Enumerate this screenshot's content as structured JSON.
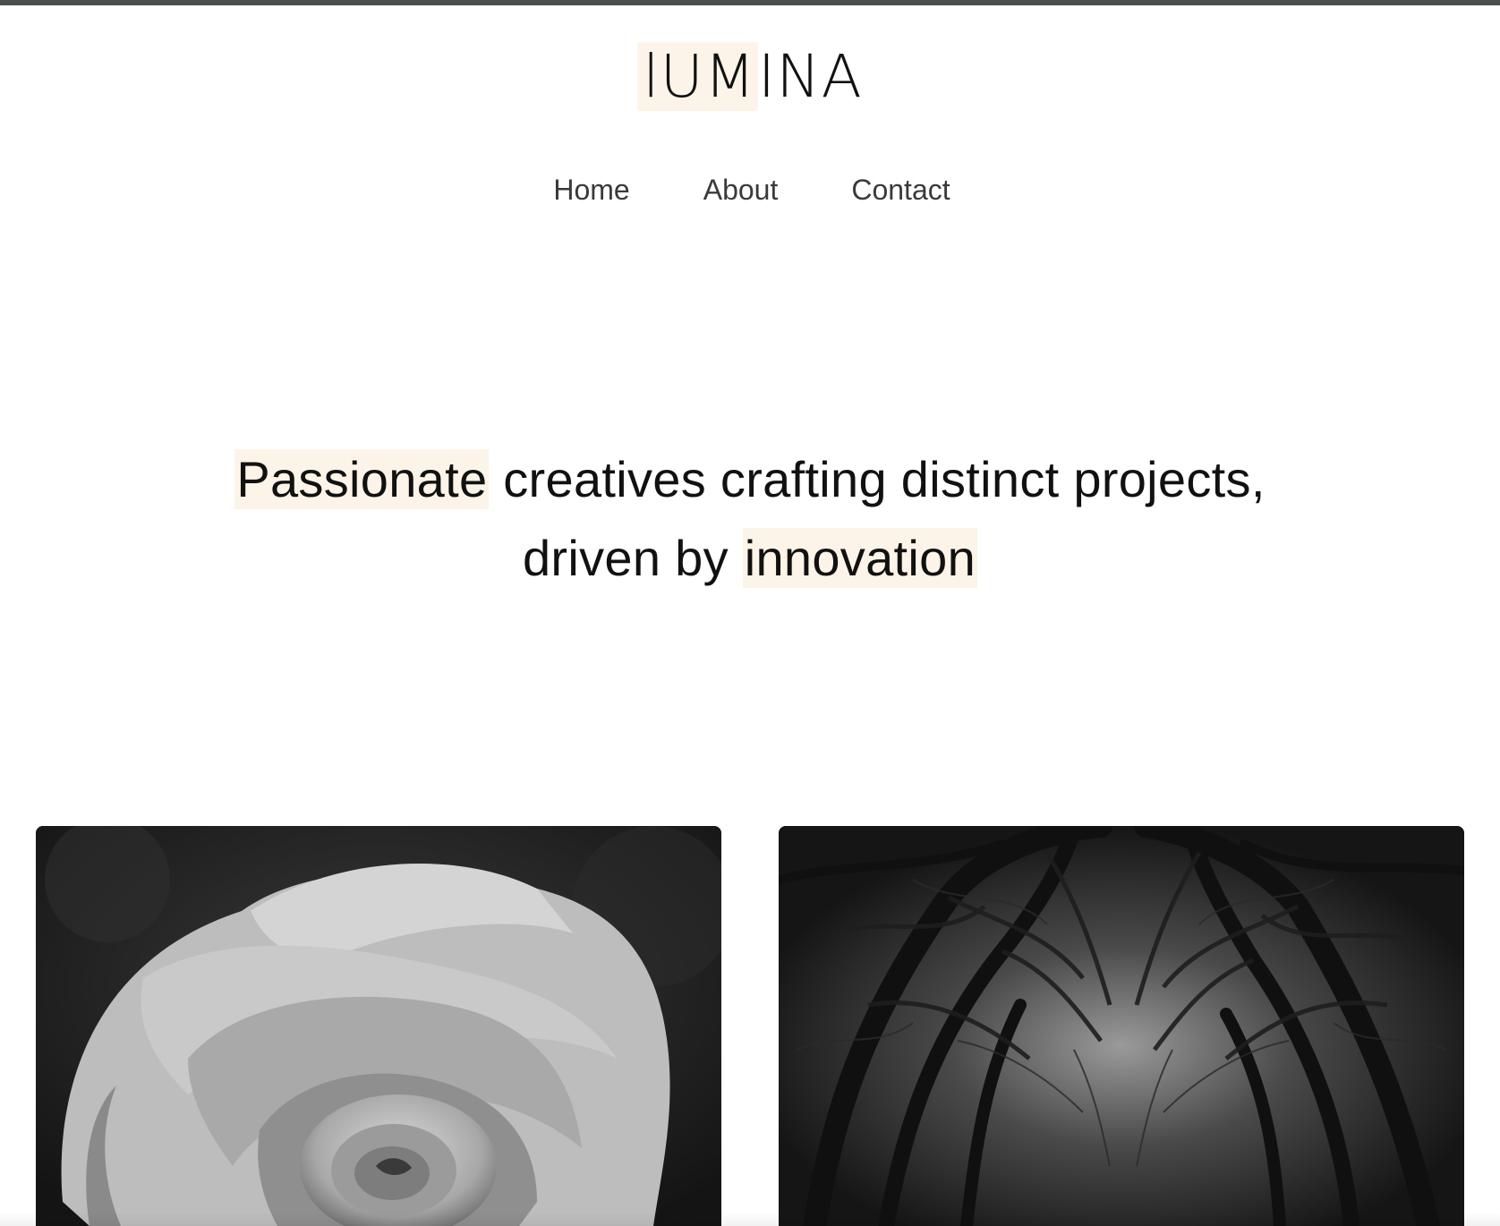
{
  "brand": {
    "name_highlighted": "lUM",
    "name_rest": "INA"
  },
  "nav": {
    "items": [
      {
        "label": "Home"
      },
      {
        "label": "About"
      },
      {
        "label": "Contact"
      }
    ]
  },
  "hero": {
    "word_1": "Passionate",
    "line_1_rest": " creatives crafting distinct projects,",
    "line_2_start": "driven by ",
    "word_2": "innovation"
  },
  "gallery": {
    "items": [
      {
        "subject": "rose"
      },
      {
        "subject": "trees"
      }
    ]
  },
  "colors": {
    "highlight": "#fcf4e8",
    "text": "#111111",
    "nav_text": "#3a3a3a",
    "top_bar": "#4a4f4f"
  }
}
